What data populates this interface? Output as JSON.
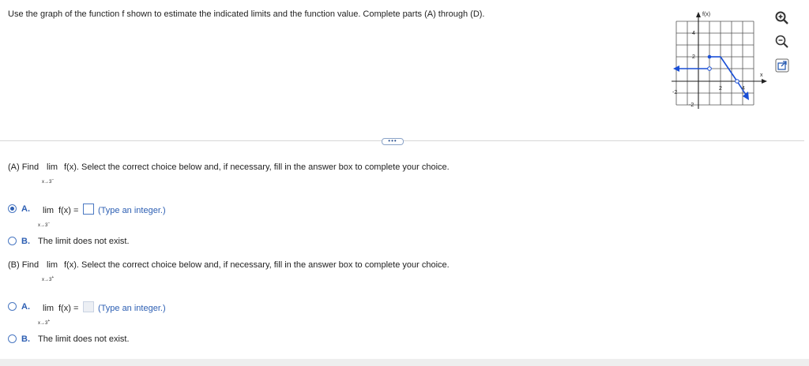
{
  "instructions": "Use the graph of the function f shown to estimate the indicated limits and the function value. Complete parts (A) through (D).",
  "graph": {
    "y_axis_label": "f(x)",
    "x_axis_label": "x",
    "y_ticks": [
      "4",
      "2",
      "-2"
    ],
    "x_ticks": [
      "-2",
      "2",
      "4"
    ]
  },
  "controls": {
    "zoom_in": "zoom-in-icon",
    "zoom_out": "zoom-out-icon",
    "popout": "popout-icon"
  },
  "divider_button": "•••",
  "partA": {
    "find": "(A) Find",
    "lim": "lim",
    "fx": "f(x). Select the correct choice below and, if necessary, fill in the answer box to complete your choice.",
    "approach": "x→3",
    "side": "−",
    "optionA": {
      "letter": "A.",
      "lim": "lim",
      "fx": "f(x) =",
      "approach": "x→3",
      "side": "−",
      "hint": "(Type an integer.)",
      "selected": true
    },
    "optionB": {
      "letter": "B.",
      "text": "The limit does not exist.",
      "selected": false
    }
  },
  "partB": {
    "find": "(B) Find",
    "lim": "lim",
    "fx": "f(x). Select the correct choice below and, if necessary, fill in the answer box to complete your choice.",
    "approach": "x→3",
    "side": "+",
    "optionA": {
      "letter": "A.",
      "lim": "lim",
      "fx": "f(x) =",
      "approach": "x→3",
      "side": "+",
      "hint": "(Type an integer.)",
      "selected": false
    },
    "optionB": {
      "letter": "B.",
      "text": "The limit does not exist.",
      "selected": false
    }
  }
}
